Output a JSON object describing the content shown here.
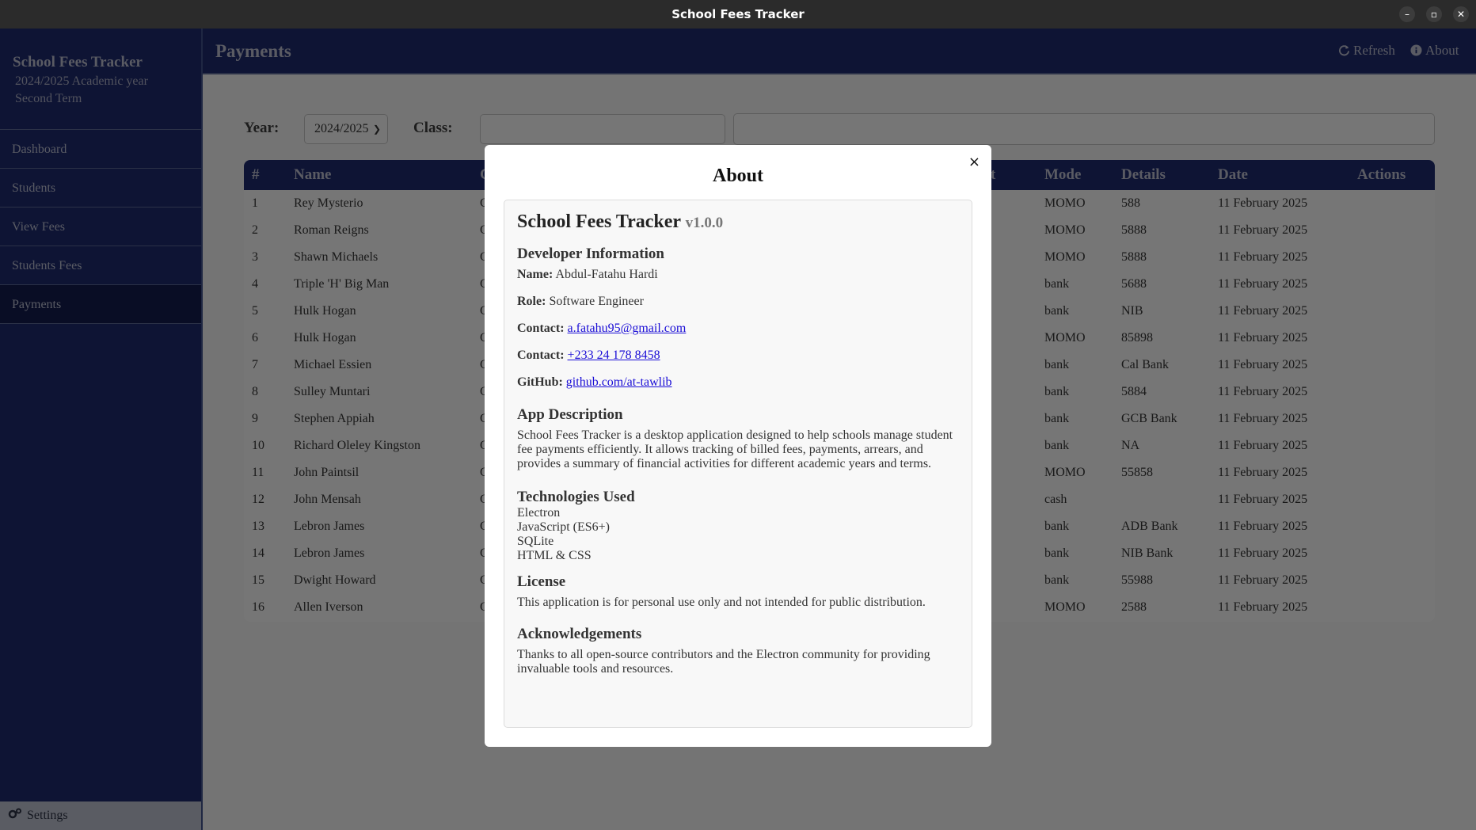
{
  "window": {
    "title": "School Fees Tracker"
  },
  "sidebar": {
    "app_name": "School Fees Tracker",
    "academic_year": "2024/2025 Academic year",
    "term": "Second Term",
    "items": [
      {
        "label": "Dashboard"
      },
      {
        "label": "Students"
      },
      {
        "label": "View Fees"
      },
      {
        "label": "Students Fees"
      },
      {
        "label": "Payments",
        "active": true
      }
    ],
    "settings_label": "Settings"
  },
  "header": {
    "title": "Payments",
    "refresh_label": "Refresh",
    "about_label": "About"
  },
  "filters": {
    "year_label": "Year:",
    "year_value": "2024/2025",
    "class_label": "Class:"
  },
  "table": {
    "columns": [
      "#",
      "Name",
      "C",
      "t",
      "Mode",
      "Details",
      "Date",
      "Actions"
    ],
    "rows": [
      {
        "num": "1",
        "name": "Rey Mysterio",
        "class": "C",
        "mode": "MOMO",
        "details": "588",
        "date": "11 February 2025"
      },
      {
        "num": "2",
        "name": "Roman Reigns",
        "class": "C",
        "mode": "MOMO",
        "details": "5888",
        "date": "11 February 2025"
      },
      {
        "num": "3",
        "name": "Shawn Michaels",
        "class": "C",
        "mode": "MOMO",
        "details": "5888",
        "date": "11 February 2025"
      },
      {
        "num": "4",
        "name": "Triple 'H' Big Man",
        "class": "C",
        "mode": "bank",
        "details": "5688",
        "date": "11 February 2025"
      },
      {
        "num": "5",
        "name": "Hulk Hogan",
        "class": "C",
        "mode": "bank",
        "details": "NIB",
        "date": "11 February 2025"
      },
      {
        "num": "6",
        "name": "Hulk Hogan",
        "class": "C",
        "mode": "MOMO",
        "details": "85898",
        "date": "11 February 2025"
      },
      {
        "num": "7",
        "name": "Michael Essien",
        "class": "C",
        "mode": "bank",
        "details": "Cal Bank",
        "date": "11 February 2025"
      },
      {
        "num": "8",
        "name": "Sulley Muntari",
        "class": "C",
        "mode": "bank",
        "details": "5884",
        "date": "11 February 2025"
      },
      {
        "num": "9",
        "name": "Stephen Appiah",
        "class": "C",
        "mode": "bank",
        "details": "GCB Bank",
        "date": "11 February 2025"
      },
      {
        "num": "10",
        "name": "Richard Oleley Kingston",
        "class": "C",
        "mode": "bank",
        "details": "NA",
        "date": "11 February 2025"
      },
      {
        "num": "11",
        "name": "John Paintsil",
        "class": "C",
        "mode": "MOMO",
        "details": "55858",
        "date": "11 February 2025"
      },
      {
        "num": "12",
        "name": "John Mensah",
        "class": "C",
        "mode": "cash",
        "details": "",
        "date": "11 February 2025"
      },
      {
        "num": "13",
        "name": "Lebron James",
        "class": "C",
        "mode": "bank",
        "details": "ADB Bank",
        "date": "11 February 2025"
      },
      {
        "num": "14",
        "name": "Lebron James",
        "class": "C",
        "mode": "bank",
        "details": "NIB Bank",
        "date": "11 February 2025"
      },
      {
        "num": "15",
        "name": "Dwight Howard",
        "class": "C",
        "mode": "bank",
        "details": "55988",
        "date": "11 February 2025"
      },
      {
        "num": "16",
        "name": "Allen Iverson",
        "class": "C",
        "mode": "MOMO",
        "details": "2588",
        "date": "11 February 2025"
      }
    ]
  },
  "modal": {
    "title": "About",
    "close_label": "×",
    "app_name": "School Fees Tracker",
    "version": "v1.0.0",
    "dev_heading": "Developer Information",
    "name_label": "Name:",
    "name_value": "Abdul-Fatahu Hardi",
    "role_label": "Role:",
    "role_value": "Software Engineer",
    "contact_label": "Contact:",
    "email": "a.fatahu95@gmail.com",
    "contact2_label": "Contact:",
    "phone": "+233 24 178 8458",
    "github_label": "GitHub:",
    "github": "github.com/at-tawlib",
    "desc_heading": "App Description",
    "desc_text": "School Fees Tracker is a desktop application designed to help schools manage student fee payments efficiently. It allows tracking of billed fees, payments, arrears, and provides a summary of financial activities for different academic years and terms.",
    "tech_heading": "Technologies Used",
    "technologies": [
      "Electron",
      "JavaScript (ES6+)",
      "SQLite",
      "HTML & CSS"
    ],
    "license_heading": "License",
    "license_text": "This application is for personal use only and not intended for public distribution.",
    "ack_heading": "Acknowledgements",
    "ack_text": "Thanks to all open-source contributors and the Electron community for providing invaluable tools and resources."
  }
}
